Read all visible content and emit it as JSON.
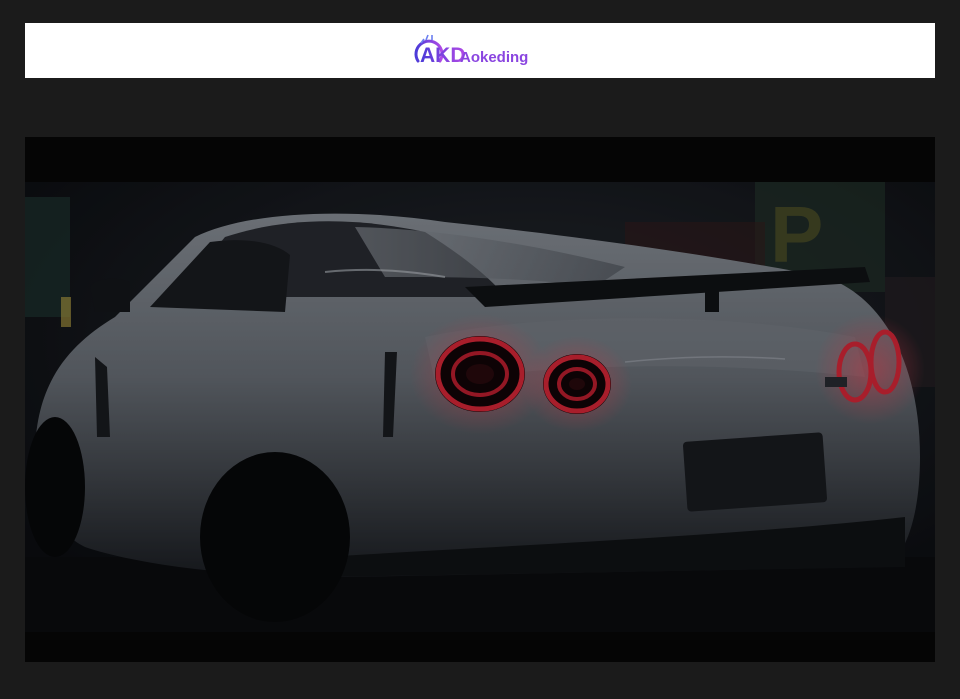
{
  "brand": {
    "mark": "AKD",
    "name": "Aokeding",
    "colors": {
      "primary": "#6a35d6",
      "accent": "#a24ce6",
      "ring": "#5b7fe8"
    }
  },
  "photo": {
    "subject": "car-rear-taillights",
    "colors": {
      "letterbox": "#050505",
      "scene_dark": "#14171c",
      "car_body": "#c9ced6",
      "taillight": "#e0283a",
      "taillight_glow": "#ff4a5c"
    }
  }
}
